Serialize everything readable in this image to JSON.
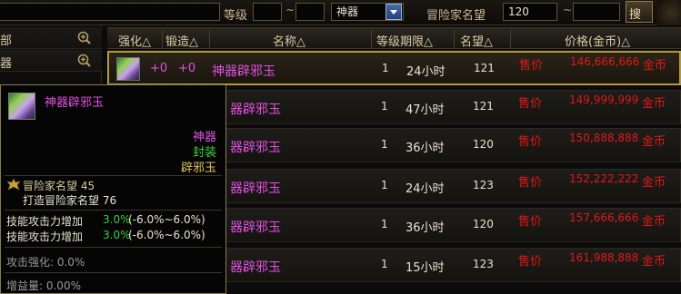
{
  "filter": {
    "level_label": "等级",
    "level_min": "",
    "level_max": "",
    "tilde": "~",
    "rarity_selected": "神器",
    "reputation_label": "冒险家名望",
    "reputation_min": "120",
    "reputation_max": "",
    "search_label": "搜"
  },
  "sidebar": {
    "items": [
      {
        "label": "部"
      },
      {
        "label": "器"
      }
    ]
  },
  "table": {
    "headers": {
      "enhance": "强化△",
      "forge": "锻造△",
      "name": "名称△",
      "level_limit": "等级期限△",
      "reputation": "名望△",
      "price": "价格(金币)△"
    },
    "rows": [
      {
        "enhance": "+0",
        "forge": "+0",
        "name": "神器辟邪玉",
        "level": "1",
        "time": "24小时",
        "reputation": "121",
        "sell": "售价",
        "price": "146,666,666",
        "unit": "金币"
      },
      {
        "name": "器辟邪玉",
        "level": "1",
        "time": "47小时",
        "reputation": "121",
        "sell": "售价",
        "price": "149,999,999",
        "unit": "金币"
      },
      {
        "name": "器辟邪玉",
        "level": "1",
        "time": "36小时",
        "reputation": "120",
        "sell": "售价",
        "price": "150,888,888",
        "unit": "金币"
      },
      {
        "name": "器辟邪玉",
        "level": "1",
        "time": "24小时",
        "reputation": "123",
        "sell": "售价",
        "price": "152,222,222",
        "unit": "金币"
      },
      {
        "name": "器辟邪玉",
        "level": "1",
        "time": "36小时",
        "reputation": "120",
        "sell": "售价",
        "price": "157,666,666",
        "unit": "金币"
      },
      {
        "name": "器辟邪玉",
        "level": "1",
        "time": "15小时",
        "reputation": "123",
        "sell": "售价",
        "price": "161,988,888",
        "unit": "金币"
      }
    ]
  },
  "tooltip": {
    "name": "神器辟邪玉",
    "rarity": "神器",
    "bind": "封装",
    "type": "辟邪玉",
    "reputation_line": "冒险家名望 45",
    "forge_reputation_line": "打造冒险家名望 76",
    "skill_label_1": "技能攻击力增加",
    "skill_value_1": "3.0%",
    "skill_range_1": "(-6.0%~6.0%)",
    "skill_label_2": "技能攻击力增加",
    "skill_value_2": "3.0%",
    "skill_range_2": "(-6.0%~6.0%)",
    "attack_enhance": "攻击强化: 0.0%",
    "gain": "增益量: 0.00%"
  },
  "colors": {
    "rarity_pink": "#e050e0",
    "price_red": "#e01818",
    "bind_green": "#3ccf3c",
    "type_gold": "#e0c060",
    "selected_border": "#b89a3c"
  }
}
